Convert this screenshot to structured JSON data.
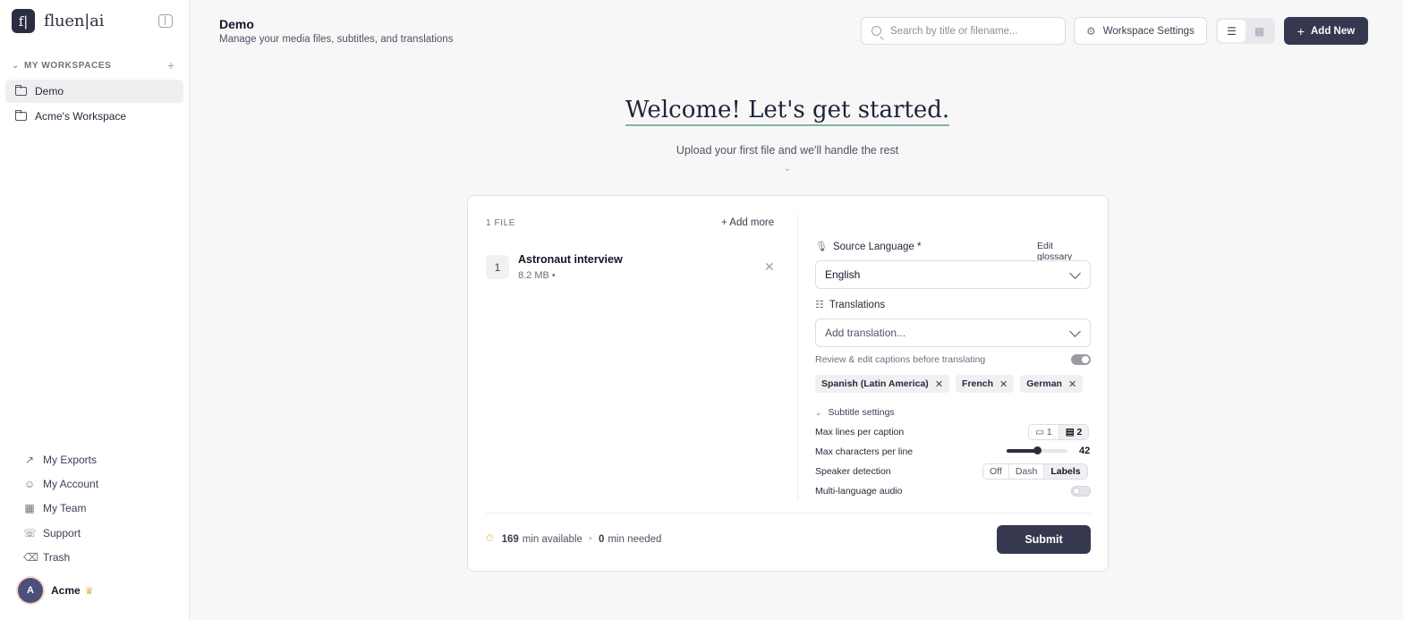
{
  "brand": {
    "logo_glyph": "f|",
    "name": "fluen|ai"
  },
  "sidebar": {
    "section_label": "MY WORKSPACES",
    "workspaces": [
      {
        "label": "Demo",
        "active": true
      },
      {
        "label": "Acme's Workspace",
        "active": false
      }
    ],
    "nav": [
      {
        "label": "My Exports",
        "icon": "exports-icon"
      },
      {
        "label": "My Account",
        "icon": "account-icon"
      },
      {
        "label": "My Team",
        "icon": "team-icon"
      },
      {
        "label": "Support",
        "icon": "support-icon"
      },
      {
        "label": "Trash",
        "icon": "trash-icon"
      }
    ],
    "user": {
      "initial": "A",
      "name": "Acme",
      "badge_icon": "crown-icon"
    }
  },
  "header": {
    "title": "Demo",
    "subtitle": "Manage your media files, subtitles, and translations",
    "search_placeholder": "Search by title or filename...",
    "workspace_settings_label": "Workspace Settings",
    "add_new_label": "Add New"
  },
  "welcome": {
    "title": "Welcome! Let's get started.",
    "subtitle": "Upload your first file and we'll handle the rest"
  },
  "upload": {
    "files_count_label": "1 FILE",
    "add_more_label": "+ Add more",
    "files": [
      {
        "index": "1",
        "name": "Astronaut interview",
        "size": "8.2 MB •"
      }
    ]
  },
  "settings": {
    "source_language_label": "Source Language *",
    "edit_glossary_label": "Edit glossary",
    "source_language_value": "English",
    "translations_label": "Translations",
    "translation_placeholder": "Add translation...",
    "review_label": "Review & edit captions before translating",
    "review_enabled": true,
    "selected_translations": [
      "Spanish (Latin America)",
      "French",
      "German"
    ],
    "subtitle_settings_label": "Subtitle settings",
    "max_lines_label": "Max lines per caption",
    "max_lines_options": [
      "1",
      "2"
    ],
    "max_lines_selected": "2",
    "max_chars_label": "Max characters per line",
    "max_chars_value": "42",
    "speaker_detection_label": "Speaker detection",
    "speaker_options": [
      "Off",
      "Dash",
      "Labels"
    ],
    "speaker_selected": "Labels",
    "multi_language_label": "Multi-language audio",
    "multi_language_enabled": false
  },
  "footer": {
    "available_minutes": "169",
    "available_label": "min available",
    "needed_minutes": "0",
    "needed_label": "min needed",
    "submit_label": "Submit"
  },
  "colors": {
    "primary": "#363850",
    "accent_underline": "#7fb7a3",
    "crown": "#e0b24a"
  }
}
